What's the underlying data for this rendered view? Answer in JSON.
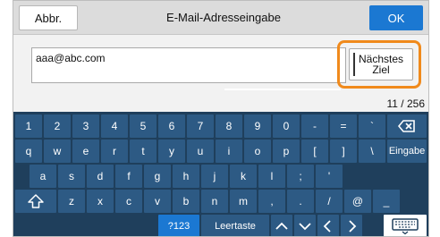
{
  "header": {
    "abbr_label": "Abbr.",
    "title": "E-Mail-Adresseingabe",
    "ok_label": "OK"
  },
  "input": {
    "value": "aaa@abc.com"
  },
  "next_button": {
    "line1": "Nächstes",
    "line2": "Ziel"
  },
  "char_count": "11 / 256",
  "keyboard": {
    "row1": [
      "1",
      "2",
      "3",
      "4",
      "5",
      "6",
      "7",
      "8",
      "9",
      "0",
      "-",
      "=",
      "`"
    ],
    "row2": [
      "q",
      "w",
      "e",
      "r",
      "t",
      "y",
      "u",
      "i",
      "o",
      "p",
      "[",
      "]",
      "\\"
    ],
    "enter_label": "Eingabe",
    "row3": [
      "a",
      "s",
      "d",
      "f",
      "g",
      "h",
      "j",
      "k",
      "l",
      ";",
      "'"
    ],
    "row4": [
      "z",
      "x",
      "c",
      "v",
      "b",
      "n",
      "m",
      ",",
      ".",
      "/",
      "@",
      "_"
    ],
    "mode_label": "?123",
    "space_label": "Leertaste"
  },
  "colors": {
    "accent": "#1b78d2",
    "highlight": "#f08a1c",
    "keyboard_bg": "#1f3f5c",
    "key": "#2d5a84"
  },
  "icons": [
    "backspace-icon",
    "shift-icon",
    "arrow-up-icon",
    "arrow-down-icon",
    "arrow-left-icon",
    "arrow-right-icon",
    "keyboard-icon"
  ]
}
